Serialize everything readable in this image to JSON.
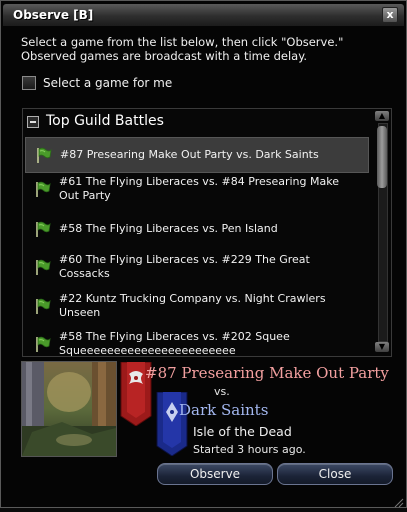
{
  "window": {
    "title": "Observe [B]",
    "close_glyph": "x"
  },
  "instructions": {
    "line1": "Select a game from the list below, then click \"Observe.\"",
    "line2": "Observed games are broadcast with a time delay."
  },
  "select_game_for_me": {
    "label": "Select a game for me",
    "checked": false
  },
  "list": {
    "title": "Top Guild Battles",
    "games": [
      {
        "line1": "#87 Presearing Make Out Party vs. Dark Saints",
        "line2": "",
        "selected": true
      },
      {
        "line1": "#61 The Flying Liberaces vs. #84 Presearing Make",
        "line2": "Out Party",
        "selected": false
      },
      {
        "line1": "#58 The Flying Liberaces vs. Pen Island",
        "line2": "",
        "selected": false
      },
      {
        "line1": "#60 The Flying Liberaces vs. #229 The Great",
        "line2": "Cossacks",
        "selected": false
      },
      {
        "line1": "#22 Kuntz Trucking Company vs. Night Crawlers",
        "line2": "Unseen",
        "selected": false
      },
      {
        "line1": "#58 The Flying Liberaces vs. #202 Squee",
        "line2": "Squeeeeeeeeeeeeeeeeeeeeeee",
        "selected": false
      }
    ]
  },
  "details": {
    "team1": "#87 Presearing Make Out Party",
    "vs": "vs.",
    "team2": "Dark Saints",
    "map": "Isle of the Dead",
    "started": "Started 3 hours ago.",
    "team1_color": "#f3a0a0",
    "team2_color": "#a4b8f0"
  },
  "buttons": {
    "observe": "Observe",
    "close": "Close"
  },
  "icons": {
    "list_item": "green-flag-icon",
    "collapse": "minus-box-icon"
  }
}
